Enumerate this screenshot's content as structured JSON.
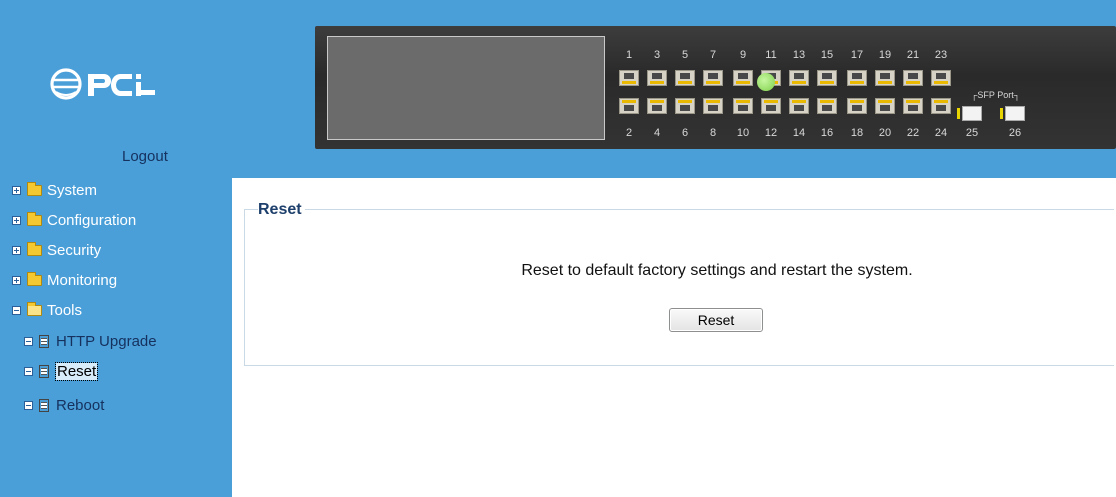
{
  "header": {
    "logo_text": "PCI",
    "logout_label": "Logout",
    "switch_panel": {
      "top_port_labels": [
        "1",
        "3",
        "5",
        "7",
        "9",
        "11",
        "13",
        "15",
        "17",
        "19",
        "21",
        "23"
      ],
      "bottom_port_labels": [
        "2",
        "4",
        "6",
        "8",
        "10",
        "12",
        "14",
        "16",
        "18",
        "20",
        "22",
        "24"
      ],
      "sfp_label": "SFP Port",
      "sfp_port_labels": [
        "25",
        "26"
      ],
      "active_port": "11",
      "active_led_color": "#7fd04a"
    }
  },
  "sidebar": {
    "items": [
      {
        "label": "System",
        "icon": "folder-icon",
        "toggle": "plus"
      },
      {
        "label": "Configuration",
        "icon": "folder-icon",
        "toggle": "plus"
      },
      {
        "label": "Security",
        "icon": "folder-icon",
        "toggle": "plus"
      },
      {
        "label": "Monitoring",
        "icon": "folder-icon",
        "toggle": "plus"
      },
      {
        "label": "Tools",
        "icon": "open-folder-icon",
        "toggle": "minus"
      }
    ],
    "tools_children": [
      {
        "label": "HTTP Upgrade",
        "icon": "page-icon"
      },
      {
        "label": "Reset",
        "icon": "page-icon",
        "selected": true
      },
      {
        "label": "Reboot",
        "icon": "page-icon"
      }
    ]
  },
  "main": {
    "section_title": "Reset",
    "message": "Reset to default factory settings and restart the system.",
    "reset_button_label": "Reset"
  },
  "colors": {
    "sidebar_bg": "#4a9fd9",
    "sidebar_text": "#ffffff",
    "link_text": "#16315e",
    "title_text": "#1d3f6b"
  }
}
